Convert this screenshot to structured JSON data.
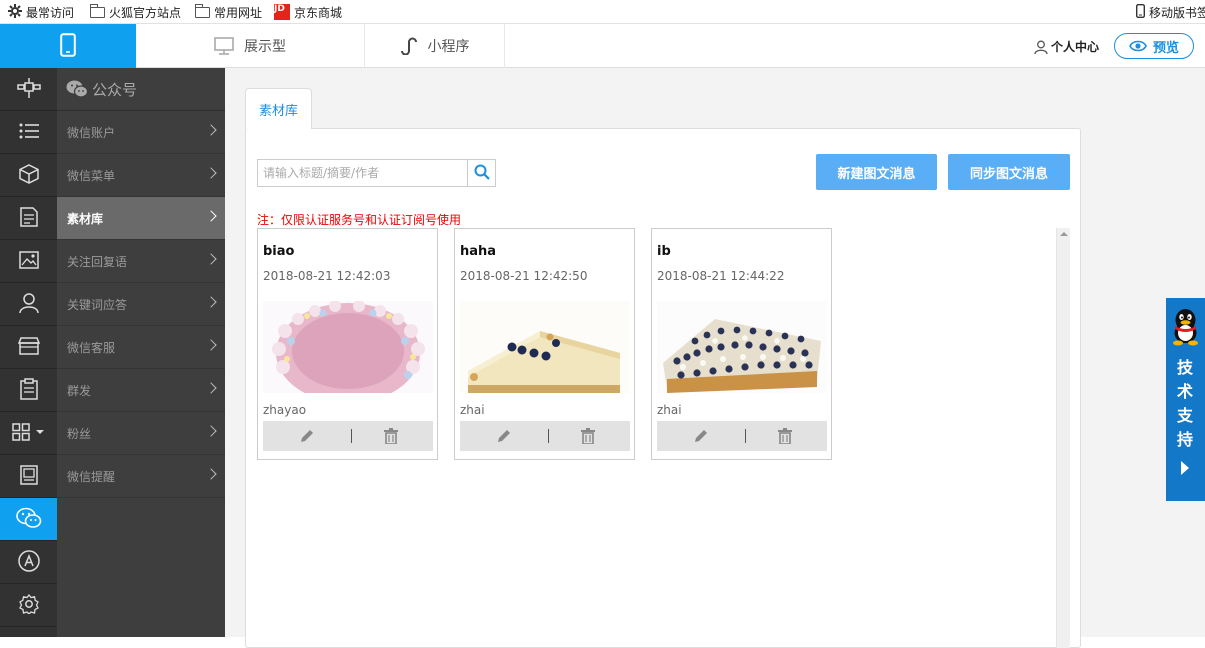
{
  "bookmarks": [
    {
      "label": "最常访问",
      "icon": "gear-icon"
    },
    {
      "label": "火狐官方站点",
      "icon": "folder-icon"
    },
    {
      "label": "常用网址",
      "icon": "folder-icon"
    },
    {
      "label": "京东商城",
      "icon": "jd-logo-icon",
      "logo_text": "JD"
    },
    {
      "label": "移动版书签",
      "icon": "mobile-icon"
    }
  ],
  "topnav": {
    "tabs": [
      {
        "label": "展示型",
        "icon": "monitor-icon"
      },
      {
        "label": "小程序",
        "icon": "mini-program-icon"
      }
    ],
    "user_center": "个人中心",
    "preview": "预览"
  },
  "rail": {
    "icons": [
      "satellite-icon",
      "list-icon",
      "cube-icon",
      "document-icon",
      "image-icon",
      "user-icon",
      "store-icon",
      "clipboard-icon",
      "apps-icon",
      "poster-icon",
      "wechat-icon",
      "appstore-icon",
      "settings-icon"
    ],
    "active_index": 10
  },
  "sidebar": {
    "title": "公众号",
    "items": [
      {
        "label": "微信账户"
      },
      {
        "label": "微信菜单"
      },
      {
        "label": "素材库",
        "active": true
      },
      {
        "label": "关注回复语"
      },
      {
        "label": "关键词应答"
      },
      {
        "label": "微信客服"
      },
      {
        "label": "群发"
      },
      {
        "label": "粉丝"
      },
      {
        "label": "微信提醒"
      }
    ]
  },
  "main": {
    "tab": "素材库",
    "search": {
      "placeholder": "请输入标题/摘要/作者",
      "value": ""
    },
    "buttons": {
      "new": "新建图文消息",
      "sync": "同步图文消息"
    },
    "note": "注：仅限认证服务号和认证订阅号使用",
    "cards": [
      {
        "title": "biao",
        "date": "2018-08-21 12:42:03",
        "author": "zhayao",
        "image": "pink-cake-photo"
      },
      {
        "title": "haha",
        "date": "2018-08-21 12:42:50",
        "author": "zhai",
        "image": "cheesecake-slice-photo"
      },
      {
        "title": "ib",
        "date": "2018-08-21 12:44:22",
        "author": "zhai",
        "image": "blueberry-tart-photo"
      }
    ]
  },
  "support": {
    "text": "技术支持"
  },
  "colors": {
    "accent": "#0fa0f0",
    "primary_btn": "#5aaef5",
    "note_red": "#e00000",
    "support_blue": "#1478c8"
  }
}
